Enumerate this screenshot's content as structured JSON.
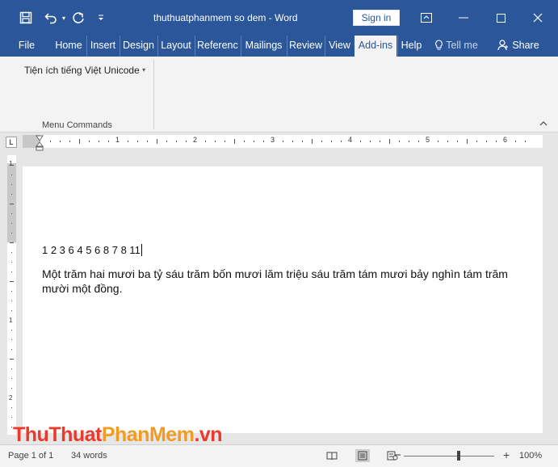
{
  "window": {
    "title": "thuthuatphanmem so dem  -  Word",
    "sign_in_label": "Sign in"
  },
  "quick_access": {
    "icons": [
      "save-icon",
      "undo-icon",
      "redo-icon",
      "customize-icon"
    ]
  },
  "ribbon_tabs": [
    {
      "label": "File"
    },
    {
      "label": "Home"
    },
    {
      "label": "Insert"
    },
    {
      "label": "Design"
    },
    {
      "label": "Layout"
    },
    {
      "label": "References"
    },
    {
      "label": "Mailings"
    },
    {
      "label": "Review"
    },
    {
      "label": "View"
    },
    {
      "label": "Add-ins",
      "active": true
    },
    {
      "label": "Help"
    },
    {
      "label": "Tell me"
    },
    {
      "label": "Share"
    }
  ],
  "ribbon": {
    "command_label": "Tiện ích tiếng Việt Unicode",
    "group_label": "Menu Commands"
  },
  "ruler": {
    "numbers": [
      "1",
      "2",
      "3",
      "4",
      "5",
      "6"
    ],
    "vertical_numbers": [
      "1",
      "1",
      "2"
    ]
  },
  "document": {
    "line1": "1 2 3 6 4 5 6 8 7 8 11",
    "paragraph": "Một trăm hai mươi ba tỷ sáu trăm bốn mươi lăm triệu sáu trăm tám mươi bảy nghìn tám trăm mười một đồng."
  },
  "watermark": {
    "part1": "ThuThuat",
    "part2": "PhanMem",
    "part3": ".vn"
  },
  "status": {
    "page": "Page 1 of 1",
    "words": "34 words",
    "zoom": "100%",
    "zoom_fraction": 0.5,
    "zoom_minus": "−",
    "zoom_plus": "+"
  },
  "colors": {
    "brand": "#2b579a",
    "watermark_red": "#e83b2e",
    "watermark_orange": "#f29b22"
  }
}
